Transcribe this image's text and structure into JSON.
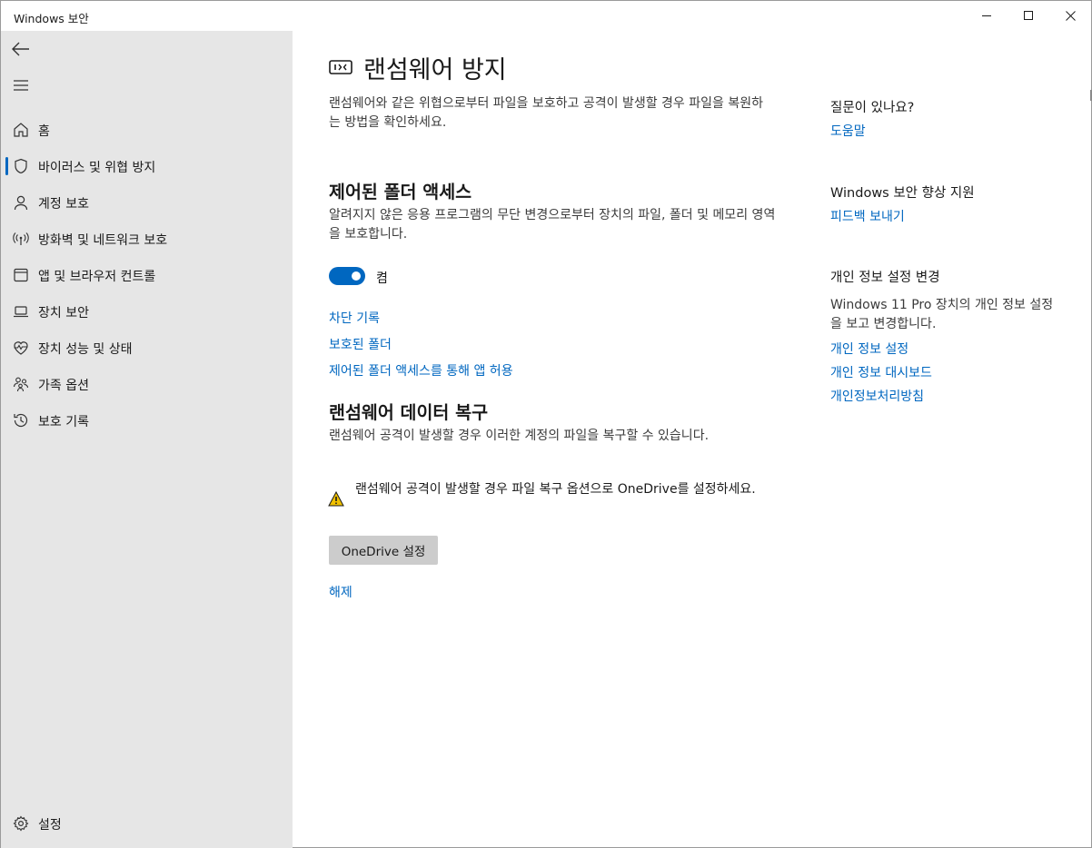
{
  "window": {
    "title": "Windows 보안"
  },
  "sidebar": {
    "items": [
      {
        "label": "홈",
        "icon": "home-icon"
      },
      {
        "label": "바이러스 및 위협 방지",
        "icon": "shield-icon",
        "selected": true
      },
      {
        "label": "계정 보호",
        "icon": "person-icon"
      },
      {
        "label": "방화벽 및 네트워크 보호",
        "icon": "antenna-icon"
      },
      {
        "label": "앱 및 브라우저 컨트롤",
        "icon": "browser-window-icon"
      },
      {
        "label": "장치 보안",
        "icon": "laptop-icon"
      },
      {
        "label": "장치 성능 및 상태",
        "icon": "heart-pulse-icon"
      },
      {
        "label": "가족 옵션",
        "icon": "family-icon"
      },
      {
        "label": "보호 기록",
        "icon": "history-icon"
      }
    ],
    "settings_label": "설정"
  },
  "main": {
    "page_title": "랜섬웨어 방지",
    "intro": "랜섬웨어와 같은 위협으로부터 파일을 보호하고 공격이 발생할 경우 파일을 복원하는 방법을 확인하세요.",
    "cfa": {
      "heading": "제어된 폴더 액세스",
      "description": "알려지지 않은 응용 프로그램의 무단 변경으로부터 장치의 파일, 폴더 및 메모리 영역을 보호합니다.",
      "toggle_label": "켬",
      "toggle_on": true,
      "links": [
        "차단 기록",
        "보호된 폴더",
        "제어된 폴더 액세스를 통해 앱 허용"
      ]
    },
    "recovery": {
      "heading": "랜섬웨어 데이터 복구",
      "description": "랜섬웨어 공격이 발생할 경우 이러한 계정의 파일을 복구할 수 있습니다.",
      "warning": "랜섬웨어 공격이 발생할 경우 파일 복구 옵션으로 OneDrive를 설정하세요.",
      "button_label": "OneDrive 설정",
      "dismiss_label": "해제"
    }
  },
  "side_panel": {
    "question": {
      "heading": "질문이 있나요?",
      "link": "도움말"
    },
    "improve": {
      "heading": "Windows 보안 향상 지원",
      "link": "피드백 보내기"
    },
    "privacy": {
      "heading": "개인 정보 설정 변경",
      "description": "Windows 11 Pro 장치의 개인 정보 설정을 보고 변경합니다.",
      "links": [
        "개인 정보 설정",
        "개인 정보 대시보드",
        "개인정보처리방침"
      ]
    }
  },
  "colors": {
    "accent": "#0067c0",
    "sidebar_bg": "#e6e6e6",
    "warning": "#f0c000"
  }
}
